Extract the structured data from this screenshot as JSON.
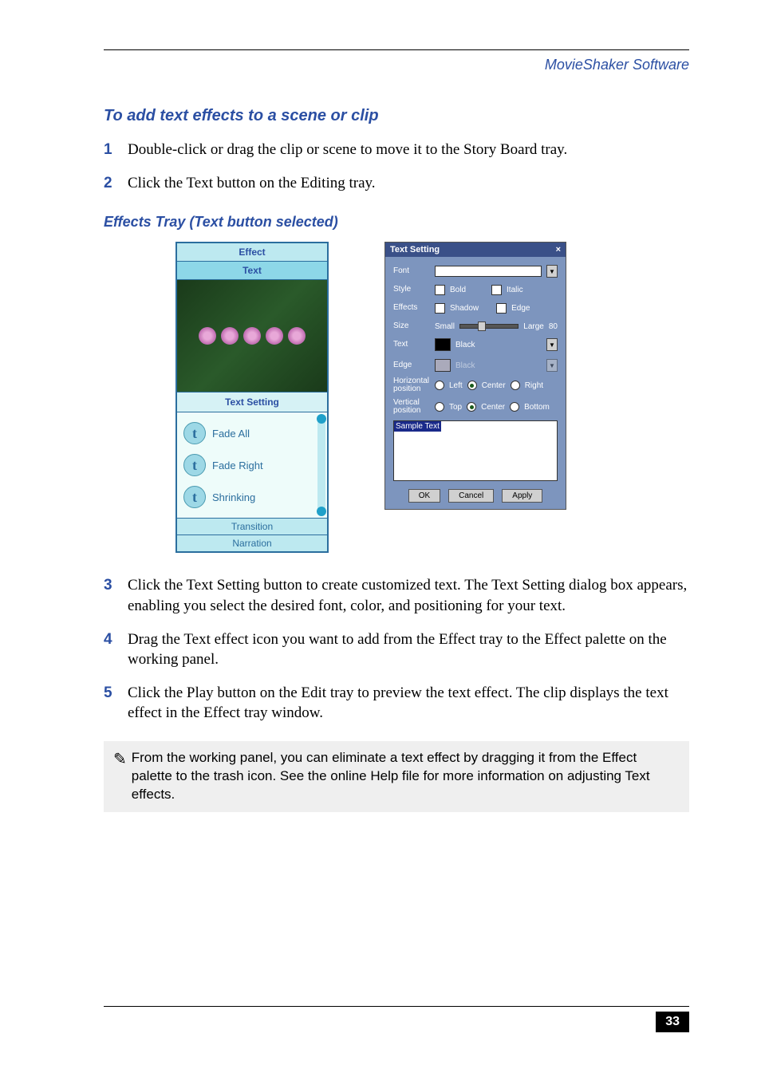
{
  "header": {
    "chapter": "MovieShaker Software"
  },
  "section": {
    "title": "To add text effects to a scene or clip"
  },
  "steps": [
    {
      "num": "1",
      "text": "Double-click or drag the clip or scene to move it to the Story Board tray."
    },
    {
      "num": "2",
      "text": "Click the Text button on the Editing tray."
    },
    {
      "num": "3",
      "text": "Click the Text Setting button to create customized text. The Text Setting dialog box appears, enabling you select the desired font, color, and positioning for your text."
    },
    {
      "num": "4",
      "text": "Drag the Text effect icon you want to add from the Effect tray to the Effect palette on the working panel."
    },
    {
      "num": "5",
      "text": "Click the Play button on the Edit tray to preview the text effect. The clip displays the text effect in the Effect tray window."
    }
  ],
  "figure_heading": "Effects Tray (Text button selected)",
  "tray": {
    "effect_tab": "Effect",
    "text_tab": "Text",
    "text_setting_btn": "Text Setting",
    "items": [
      "Fade All",
      "Fade Right",
      "Shrinking"
    ],
    "transition_tab": "Transition",
    "narration_tab": "Narration"
  },
  "dialog": {
    "title": "Text Setting",
    "labels": {
      "font": "Font",
      "style": "Style",
      "effects": "Effects",
      "size": "Size",
      "text": "Text",
      "edge": "Edge",
      "hpos": "Horizontal position",
      "vpos": "Vertical position"
    },
    "style": {
      "bold": "Bold",
      "italic": "Italic"
    },
    "effects": {
      "shadow": "Shadow",
      "edge": "Edge"
    },
    "size": {
      "small": "Small",
      "large": "Large",
      "value": "80"
    },
    "colors": {
      "text": "Black",
      "edge": "Black"
    },
    "hpos_opts": [
      "Left",
      "Center",
      "Right"
    ],
    "vpos_opts": [
      "Top",
      "Center",
      "Bottom"
    ],
    "hpos_sel": "Center",
    "vpos_sel": "Center",
    "sample": "Sample Text",
    "buttons": {
      "ok": "OK",
      "cancel": "Cancel",
      "apply": "Apply"
    }
  },
  "note": {
    "icon": "✎",
    "text": "From the working panel, you can eliminate a text effect by dragging it from the Effect palette to the trash icon. See the online Help file for more information on adjusting Text effects."
  },
  "page": {
    "number": "33"
  }
}
